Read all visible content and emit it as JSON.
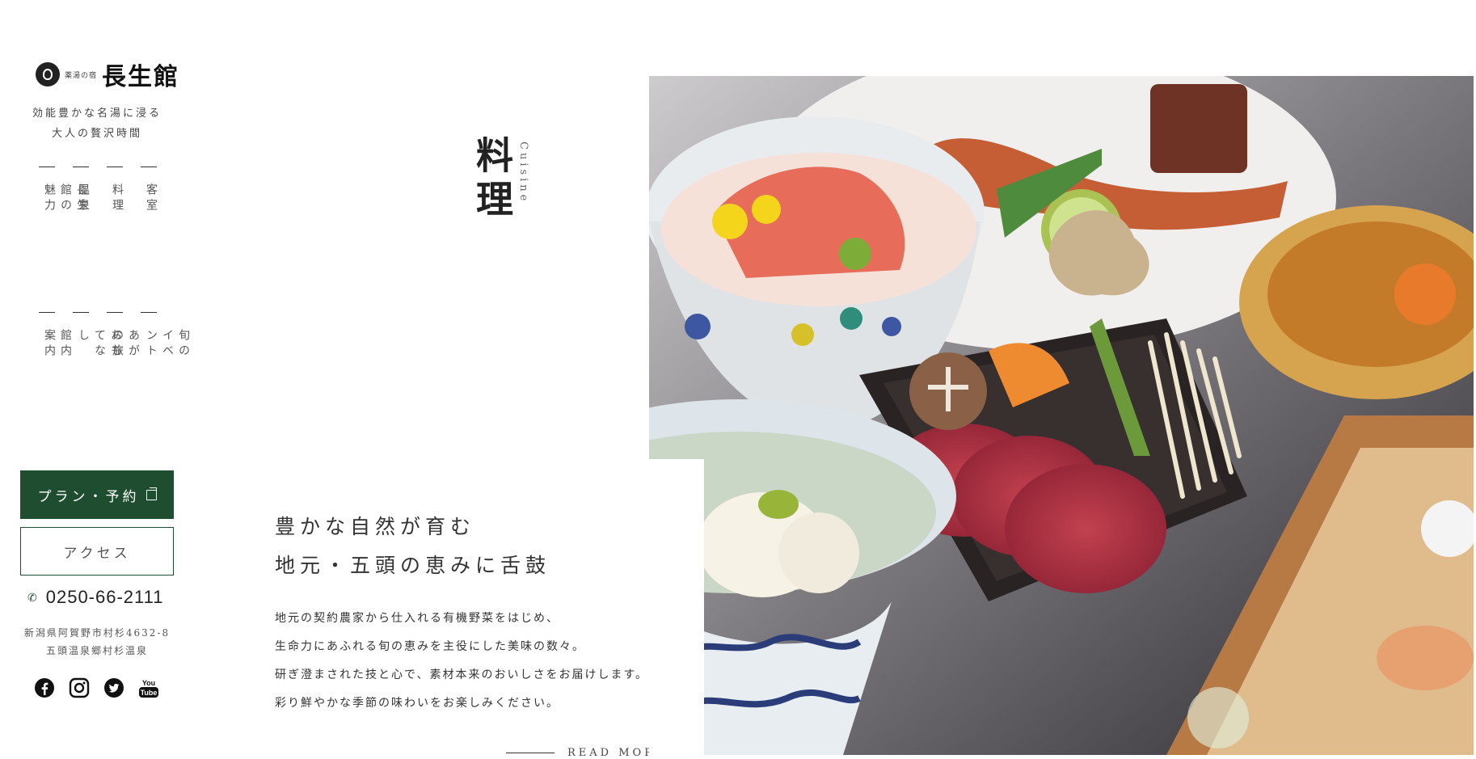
{
  "brand": {
    "small_text": "薬湯の宿",
    "name": "長生館"
  },
  "tagline": {
    "line1": "効能豊かな名湯に浸る",
    "line2": "大人の贅沢時間"
  },
  "nav": {
    "row1": [
      {
        "label": "長生館の魅力"
      },
      {
        "label": "温泉"
      },
      {
        "label": "料理"
      },
      {
        "label": "客室"
      }
    ],
    "row2": [
      {
        "label": "館内案内"
      },
      {
        "label": "おもてなし"
      },
      {
        "label": "あがの旅"
      },
      {
        "label": "旬のイベント"
      }
    ]
  },
  "buttons": {
    "plan": "プラン・予約",
    "access": "アクセス"
  },
  "contact": {
    "phone": "0250-66-2111",
    "address_line1": "新潟県阿賀野市村杉4632-8",
    "address_line2": "五頭温泉郷村杉温泉"
  },
  "social": [
    "facebook-icon",
    "instagram-icon",
    "twitter-icon",
    "youtube-icon"
  ],
  "section": {
    "title": "料理",
    "subtitle": "Cuisine",
    "catch_line1": "豊かな自然が育む",
    "catch_line2": "地元・五頭の恵みに舌鼓",
    "body": [
      "地元の契約農家から仕入れる有機野菜をはじめ、",
      "生命力にあふれる旬の恵みを主役にした美味の数々。",
      "研ぎ澄まされた技と心で、素材本来のおいしさをお届けします。",
      "彩り鮮やかな季節の味わいをお楽しみください。"
    ],
    "read_more": "READ MORE"
  },
  "colors": {
    "accent": "#1f4d30",
    "text": "#333333"
  }
}
